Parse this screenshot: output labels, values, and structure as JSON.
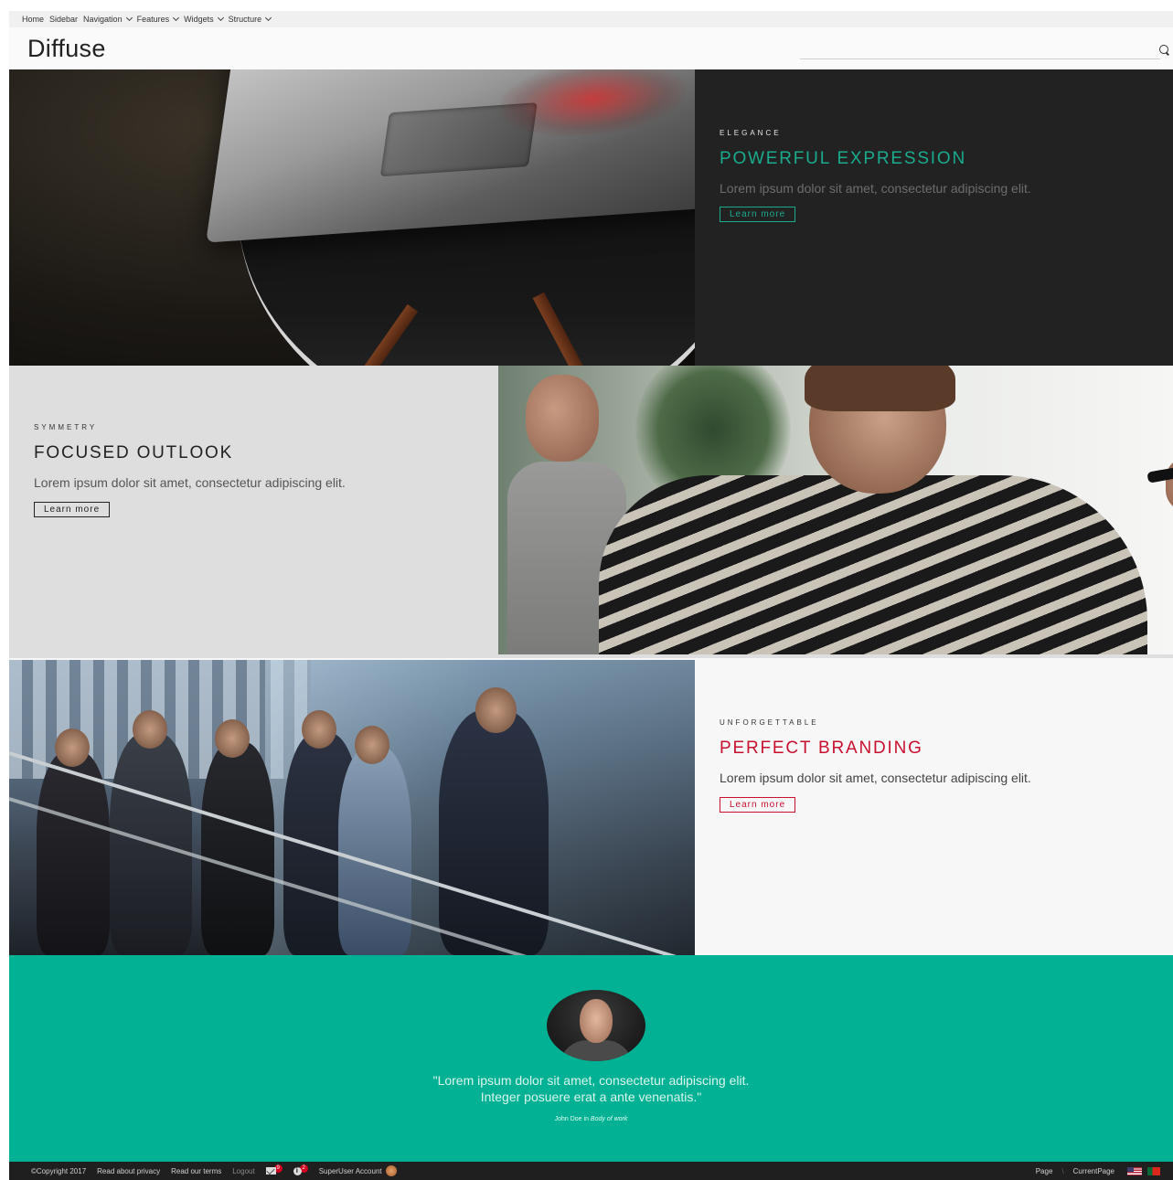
{
  "nav": {
    "items": [
      {
        "label": "Home",
        "has_dropdown": false
      },
      {
        "label": "Sidebar",
        "has_dropdown": false
      },
      {
        "label": "Navigation",
        "has_dropdown": true
      },
      {
        "label": "Features",
        "has_dropdown": true
      },
      {
        "label": "Widgets",
        "has_dropdown": true
      },
      {
        "label": "Structure",
        "has_dropdown": true
      }
    ]
  },
  "header": {
    "brand": "Diffuse",
    "search_placeholder": ""
  },
  "sections": {
    "elegance": {
      "eyebrow": "ELEGANCE",
      "headline": "POWERFUL EXPRESSION",
      "description": "Lorem ipsum dolor sit amet, consectetur adipiscing elit.",
      "button": "Learn more",
      "accent": "#1aab8e"
    },
    "symmetry": {
      "eyebrow": "SYMMETRY",
      "headline": "FOCUSED OUTLOOK",
      "description": "Lorem ipsum dolor sit amet, consectetur adipiscing elit.",
      "button": "Learn more",
      "accent": "#222222"
    },
    "unforgettable": {
      "eyebrow": "UNFORGETTABLE",
      "headline": "PERFECT BRANDING",
      "description": "Lorem ipsum dolor sit amet, consectetur adipiscing elit.",
      "button": "Learn more",
      "accent": "#c8102e"
    }
  },
  "testimonial": {
    "quote_line1": "\"Lorem ipsum dolor sit amet, consectetur adipiscing elit.",
    "quote_line2": "Integer posuere erat a ante venenatis.\"",
    "author": "John Doe in",
    "source": "Body of work",
    "background": "#00b293"
  },
  "footer": {
    "copyright": "©Copyright 2017",
    "privacy": "Read about privacy",
    "terms": "Read our terms",
    "logout": "Logout",
    "messages_count": "9",
    "notifications_count": "2",
    "account": "SuperUser Account",
    "breadcrumb_page": "Page",
    "breadcrumb_sep": "\\",
    "breadcrumb_current": "CurrentPage"
  },
  "icons": {
    "search": "search-icon",
    "messages": "mail-icon",
    "notifications": "info-icon",
    "lang_en": "flag-us-icon",
    "lang_pt": "flag-pt-icon"
  }
}
